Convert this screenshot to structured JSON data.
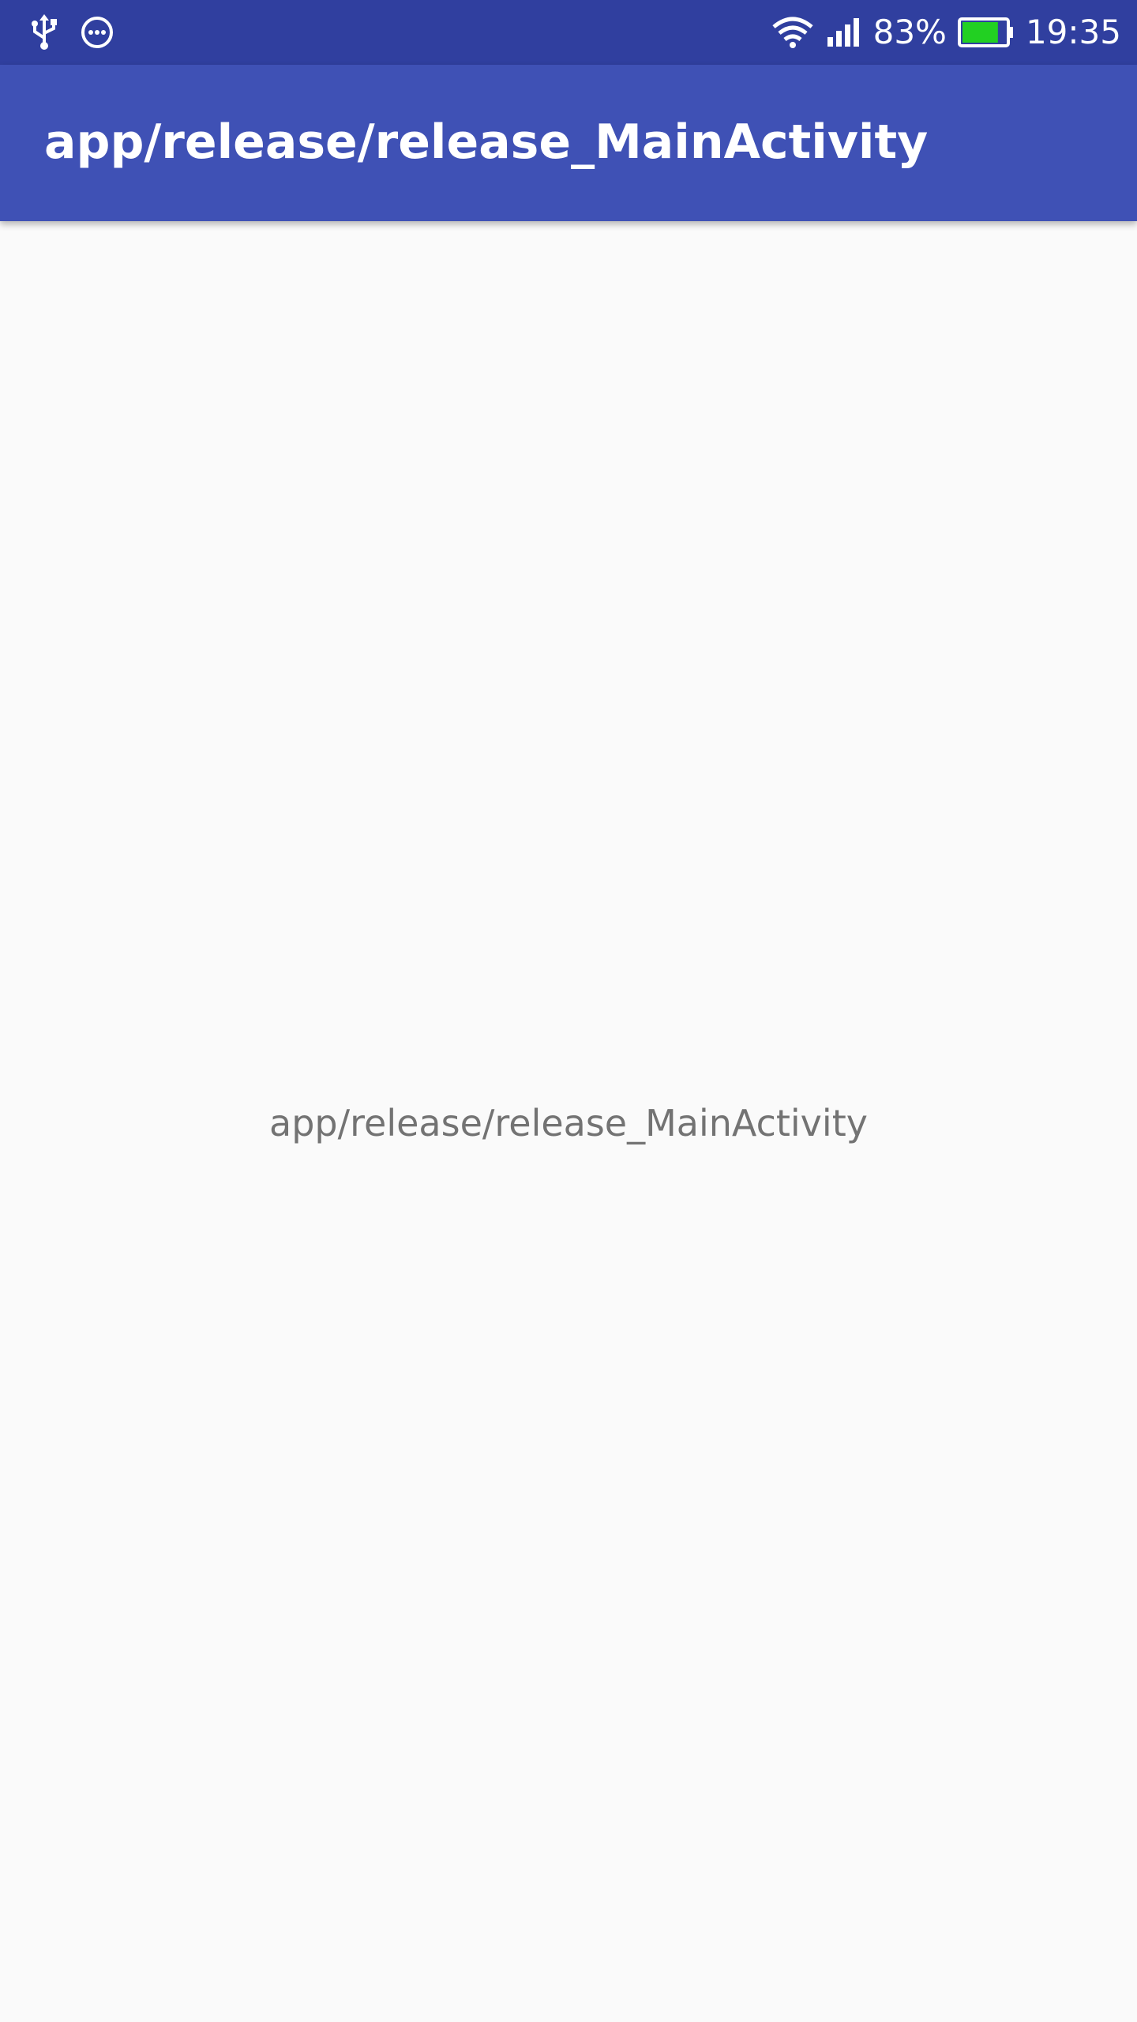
{
  "status_bar": {
    "left_icons": [
      "usb-icon",
      "more-circle-icon"
    ],
    "right_icons": [
      "wifi-icon",
      "cellular-signal-icon",
      "battery-icon"
    ],
    "battery_percent": "83%",
    "battery_level": 0.83,
    "time": "19:35",
    "colors": {
      "background": "#303f9f",
      "battery_fill": "#22d022"
    }
  },
  "app_bar": {
    "title": "app/release/release_MainActivity",
    "background": "#3f51b5"
  },
  "main": {
    "center_text": "app/release/release_MainActivity"
  }
}
